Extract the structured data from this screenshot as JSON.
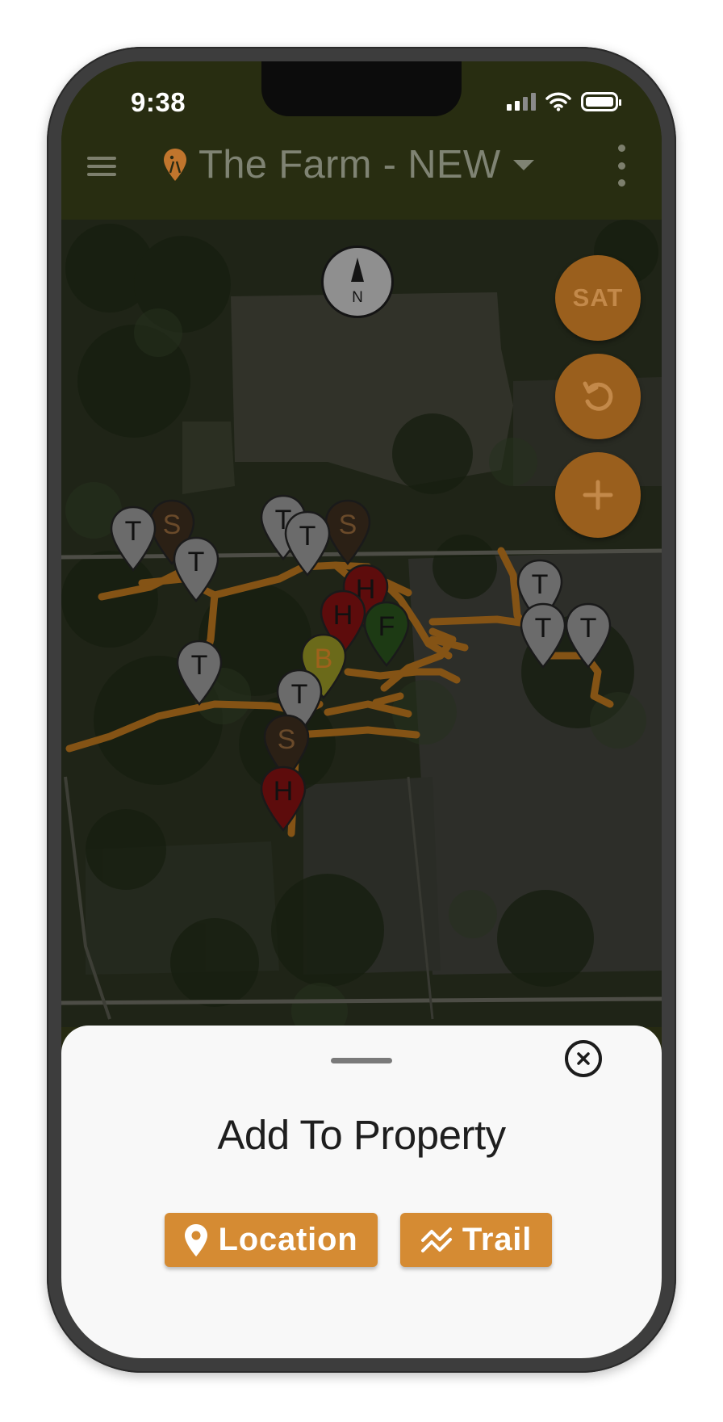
{
  "status_bar": {
    "time": "9:38"
  },
  "header": {
    "property_title": "The Farm - NEW"
  },
  "map": {
    "compass_label": "N",
    "controls": {
      "map_type_label": "SAT"
    },
    "markers": [
      {
        "letter": "S",
        "kind": "stand"
      },
      {
        "letter": "T",
        "kind": "trail-cam"
      },
      {
        "letter": "T",
        "kind": "trail-cam"
      },
      {
        "letter": "S",
        "kind": "stand"
      },
      {
        "letter": "T",
        "kind": "trail-cam"
      },
      {
        "letter": "T",
        "kind": "trail-cam"
      },
      {
        "letter": "H",
        "kind": "hunt"
      },
      {
        "letter": "H",
        "kind": "hunt"
      },
      {
        "letter": "F",
        "kind": "food"
      },
      {
        "letter": "T",
        "kind": "trail-cam"
      },
      {
        "letter": "B",
        "kind": "bedding"
      },
      {
        "letter": "T",
        "kind": "trail-cam"
      },
      {
        "letter": "S",
        "kind": "stand"
      },
      {
        "letter": "H",
        "kind": "hunt"
      },
      {
        "letter": "T",
        "kind": "trail-cam"
      },
      {
        "letter": "T",
        "kind": "trail-cam"
      },
      {
        "letter": "T",
        "kind": "trail-cam"
      }
    ],
    "colors": {
      "trail": "#b8741e",
      "pin_t": "#6b6b6b",
      "pin_s": "#2b2015",
      "pin_h": "#5d0c0c",
      "pin_f": "#1d3a14",
      "pin_b": "#6b6a1a",
      "letter_dark": "#111111",
      "letter_s": "#6a4a2a",
      "letter_b": "#a0621c"
    }
  },
  "sheet": {
    "title": "Add To Property",
    "location_label": "Location",
    "trail_label": "Trail"
  },
  "colors": {
    "accent": "#d58b33",
    "header_bg": "#282d11",
    "fab_bg": "#9a5f1d"
  }
}
